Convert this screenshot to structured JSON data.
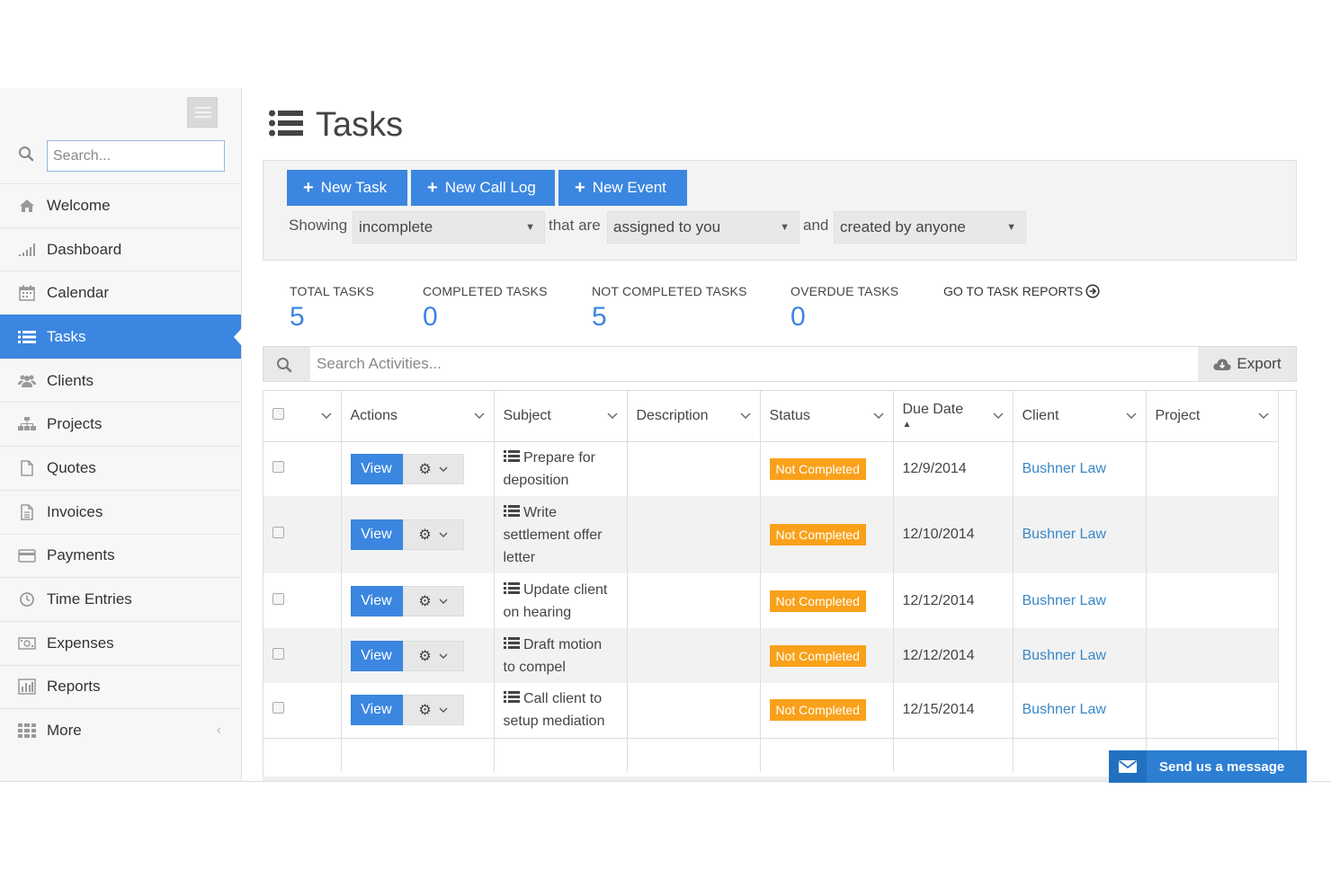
{
  "sidebar": {
    "search_placeholder": "Search...",
    "items": [
      {
        "label": "Welcome",
        "icon": "home-icon"
      },
      {
        "label": "Dashboard",
        "icon": "signal-icon"
      },
      {
        "label": "Calendar",
        "icon": "calendar-icon"
      },
      {
        "label": "Tasks",
        "icon": "list-icon",
        "active": true
      },
      {
        "label": "Clients",
        "icon": "users-icon"
      },
      {
        "label": "Projects",
        "icon": "sitemap-icon"
      },
      {
        "label": "Quotes",
        "icon": "file-icon"
      },
      {
        "label": "Invoices",
        "icon": "file-text-icon"
      },
      {
        "label": "Payments",
        "icon": "credit-card-icon"
      },
      {
        "label": "Time Entries",
        "icon": "clock-icon"
      },
      {
        "label": "Expenses",
        "icon": "money-icon"
      },
      {
        "label": "Reports",
        "icon": "bar-chart-icon"
      },
      {
        "label": "More",
        "icon": "grid-icon"
      }
    ]
  },
  "page": {
    "title": "Tasks"
  },
  "toolbar": {
    "new_task": "New Task",
    "new_call_log": "New Call Log",
    "new_event": "New Event",
    "showing_label": "Showing",
    "showing_value": "incomplete",
    "that_are_label": "that are",
    "assigned_value": "assigned to you",
    "and_label": "and",
    "created_value": "created by anyone"
  },
  "stats": {
    "total_label": "TOTAL TASKS",
    "total_value": "5",
    "completed_label": "COMPLETED TASKS",
    "completed_value": "0",
    "not_completed_label": "NOT COMPLETED TASKS",
    "not_completed_value": "5",
    "overdue_label": "OVERDUE TASKS",
    "overdue_value": "0",
    "reports_link": "GO TO TASK REPORTS"
  },
  "search": {
    "placeholder": "Search Activities...",
    "export_label": "Export"
  },
  "table": {
    "headers": {
      "actions": "Actions",
      "subject": "Subject",
      "description": "Description",
      "status": "Status",
      "due_date": "Due Date",
      "client": "Client",
      "project": "Project"
    },
    "view_label": "View",
    "rows": [
      {
        "subject": "Prepare for deposition",
        "description": "",
        "status": "Not Completed",
        "due": "12/9/2014",
        "client": "Bushner Law",
        "project": ""
      },
      {
        "subject": "Write settlement offer letter",
        "description": "",
        "status": "Not Completed",
        "due": "12/10/2014",
        "client": "Bushner Law",
        "project": ""
      },
      {
        "subject": "Update client on hearing",
        "description": "",
        "status": "Not Completed",
        "due": "12/12/2014",
        "client": "Bushner Law",
        "project": ""
      },
      {
        "subject": "Draft motion to compel",
        "description": "",
        "status": "Not Completed",
        "due": "12/12/2014",
        "client": "Bushner Law",
        "project": ""
      },
      {
        "subject": "Call client to setup mediation",
        "description": "",
        "status": "Not Completed",
        "due": "12/15/2014",
        "client": "Bushner Law",
        "project": ""
      }
    ]
  },
  "chat": {
    "label": "Send us a message"
  },
  "colors": {
    "primary": "#3b86e0",
    "status_warning": "#f9a11b",
    "link": "#3a87c8"
  }
}
